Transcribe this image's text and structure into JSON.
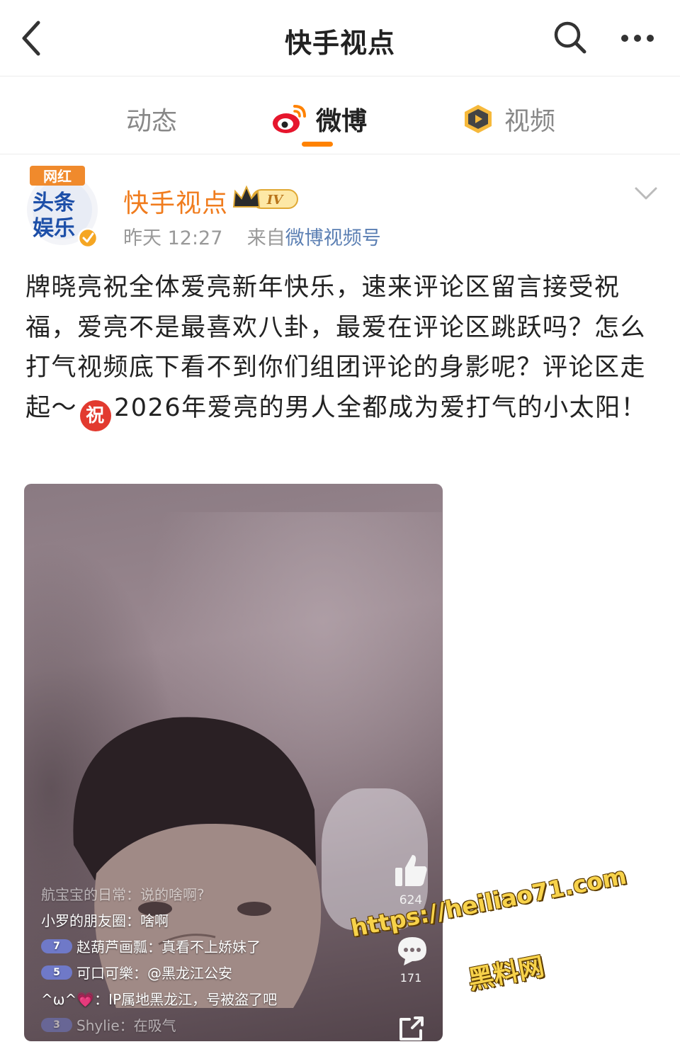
{
  "nav": {
    "title": "快手视点"
  },
  "tabs": [
    {
      "label": "动态",
      "active": false
    },
    {
      "label": "微博",
      "active": true
    },
    {
      "label": "视频",
      "active": false
    }
  ],
  "post": {
    "avatar": {
      "tag": "网红",
      "line1": "头条",
      "line2": "娱乐"
    },
    "author": "快手视点",
    "vip_level": "IV",
    "time": "昨天 12:27",
    "source_prefix": "来自",
    "source": "微博视频号",
    "text_before_emoji": "牌晓亮祝全体爱亮新年快乐，速来评论区留言接受祝福，爱亮不是最喜欢八卦，最爱在评论区跳跃吗？怎么打气视频底下看不到你们组团评论的身影呢？评论区走起～",
    "emoji": "祝",
    "text_after_emoji": "2026年爱亮的男人全都成为爱打气的小太阳！"
  },
  "video": {
    "like_count": "624",
    "comment_count": "171",
    "live_comments": [
      {
        "text": "航宝宝的日常：说的啥啊?",
        "badge": "",
        "faded": true
      },
      {
        "text": "小罗的朋友圈：啥啊",
        "badge": "",
        "faded": false
      },
      {
        "text": "赵葫芦画瓢：真看不上娇妹了",
        "badge": "7",
        "faded": false
      },
      {
        "text": "可口可樂：@黑龙江公安",
        "badge": "5",
        "faded": false
      },
      {
        "text": "^ω^💗：IP属地黑龙江，号被盗了吧",
        "badge": "",
        "faded": false
      },
      {
        "text": "Shylie：在吸气",
        "badge": "3",
        "faded": true
      }
    ]
  },
  "watermark": {
    "url": "https://heiliao71.com",
    "name": "黑料网"
  },
  "colors": {
    "accent": "#ff8200",
    "author_name": "#f07c1e",
    "link": "#5b7fb3"
  }
}
